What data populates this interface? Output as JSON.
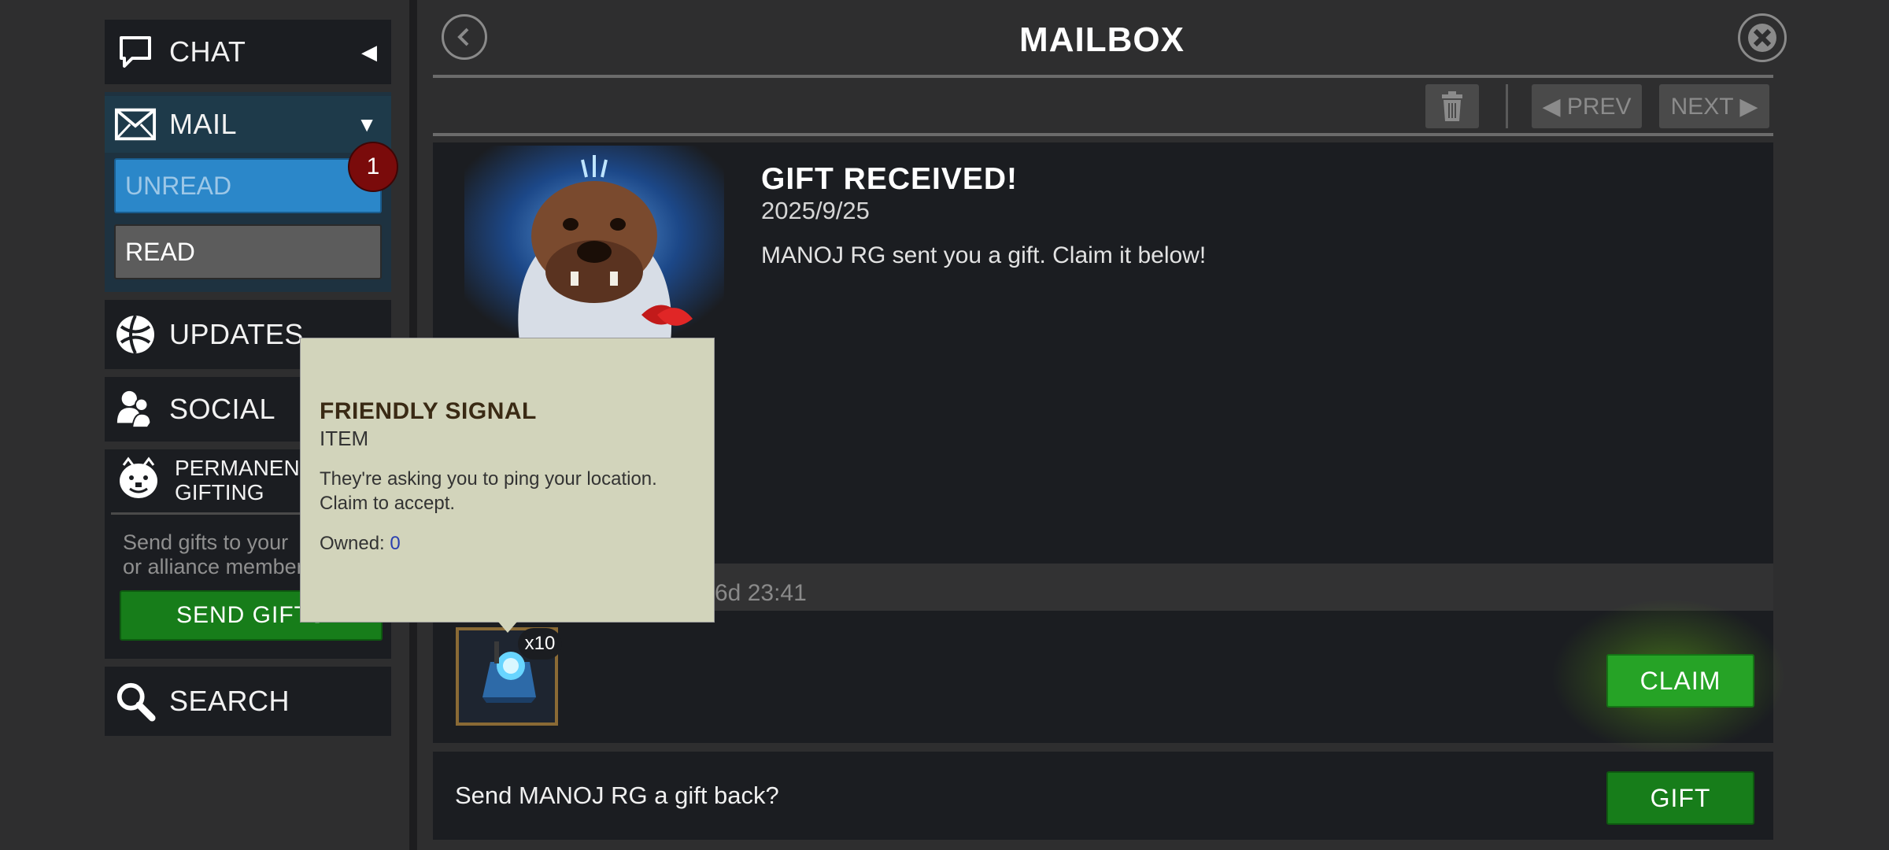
{
  "sidebar": {
    "chat_label": "CHAT",
    "mail_label": "MAIL",
    "unread_label": "UNREAD",
    "read_label": "READ",
    "unread_badge": "1",
    "updates_label": "UPDATES",
    "social_label": "SOCIAL",
    "permanent_gifting_line1": "PERMANENT",
    "permanent_gifting_line2": "GIFTING",
    "gifting_desc_line1": "Send gifts to your",
    "gifting_desc_line2": "or alliance members",
    "send_gifts_label": "SEND GIFTS",
    "search_label": "SEARCH"
  },
  "header": {
    "title": "MAILBOX",
    "prev_label": "◀ PREV",
    "next_label": "NEXT ▶"
  },
  "mail": {
    "subject": "GIFT RECEIVED!",
    "date": "2025/9/25",
    "body": "MANOJ RG sent you a gift. Claim it below!",
    "expires": "6d 23:41",
    "item_count": "x10",
    "claim_label": "CLAIM",
    "gift_back_text": "Send MANOJ RG a gift back?",
    "gift_label": "GIFT"
  },
  "tooltip": {
    "title": "FRIENDLY SIGNAL",
    "type": "ITEM",
    "desc_line1": "They're asking you to ping your location.",
    "desc_line2": "Claim to accept.",
    "owned_label": "Owned:",
    "owned_value": "0"
  },
  "colors": {
    "accent_blue": "#2b87c9",
    "claim_green": "#1f8f21",
    "badge_red": "#7a0b0b",
    "tooltip_bg": "#d2d4bb"
  }
}
